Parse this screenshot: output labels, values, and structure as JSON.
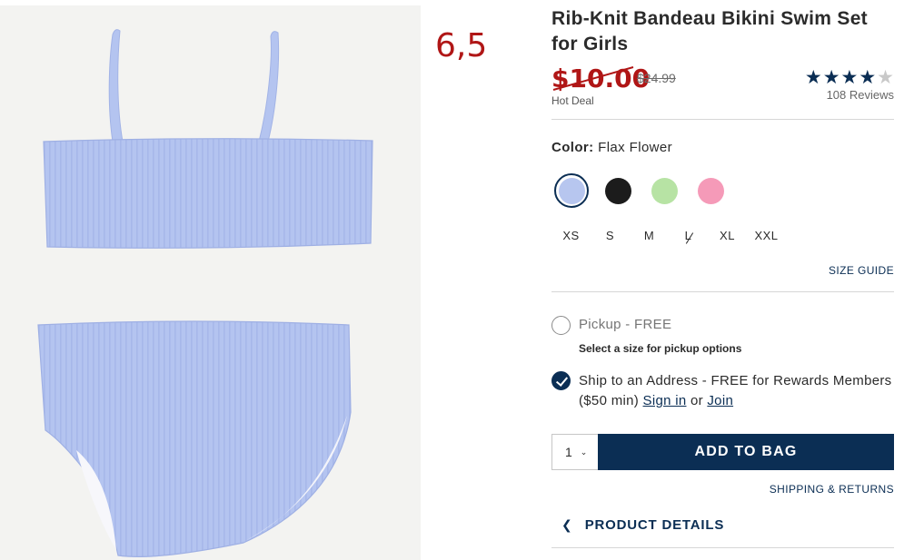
{
  "annotation": "6,5",
  "product": {
    "title": "Rib-Knit Bandeau Bikini Swim Set for Girls",
    "sale_price": "$10.00",
    "original_price": "$24.99",
    "deal_label": "Hot Deal",
    "rating": {
      "stars": 4,
      "max": 5,
      "reviews_text": "108 Reviews"
    }
  },
  "color": {
    "label": "Color:",
    "selected_name": "Flax Flower",
    "swatches": [
      {
        "name": "Flax Flower",
        "hex": "#b7c6ef",
        "selected": true
      },
      {
        "name": "black",
        "hex": "#1c1c1c",
        "selected": false
      },
      {
        "name": "green",
        "hex": "#b7e3a4",
        "selected": false
      },
      {
        "name": "pink",
        "hex": "#f59ab8",
        "selected": false
      }
    ]
  },
  "sizes": [
    {
      "label": "XS",
      "available": true
    },
    {
      "label": "S",
      "available": true
    },
    {
      "label": "M",
      "available": true
    },
    {
      "label": "L",
      "available": false
    },
    {
      "label": "XL",
      "available": true
    },
    {
      "label": "XXL",
      "available": true
    }
  ],
  "size_guide": "SIZE GUIDE",
  "fulfillment": {
    "pickup_label": "Pickup - FREE",
    "pickup_note": "Select a size for pickup options",
    "ship_text_1": "Ship to an Address - FREE for Rewards Members ($50 min) ",
    "sign_in": "Sign in",
    "or_text": " or ",
    "join": "Join"
  },
  "quantity": "1",
  "add_to_bag": "ADD TO BAG",
  "shipping_returns": "SHIPPING & RETURNS",
  "product_details": "PRODUCT DETAILS",
  "colors": {
    "navy": "#0b2e54",
    "sale_red": "#b01616"
  }
}
